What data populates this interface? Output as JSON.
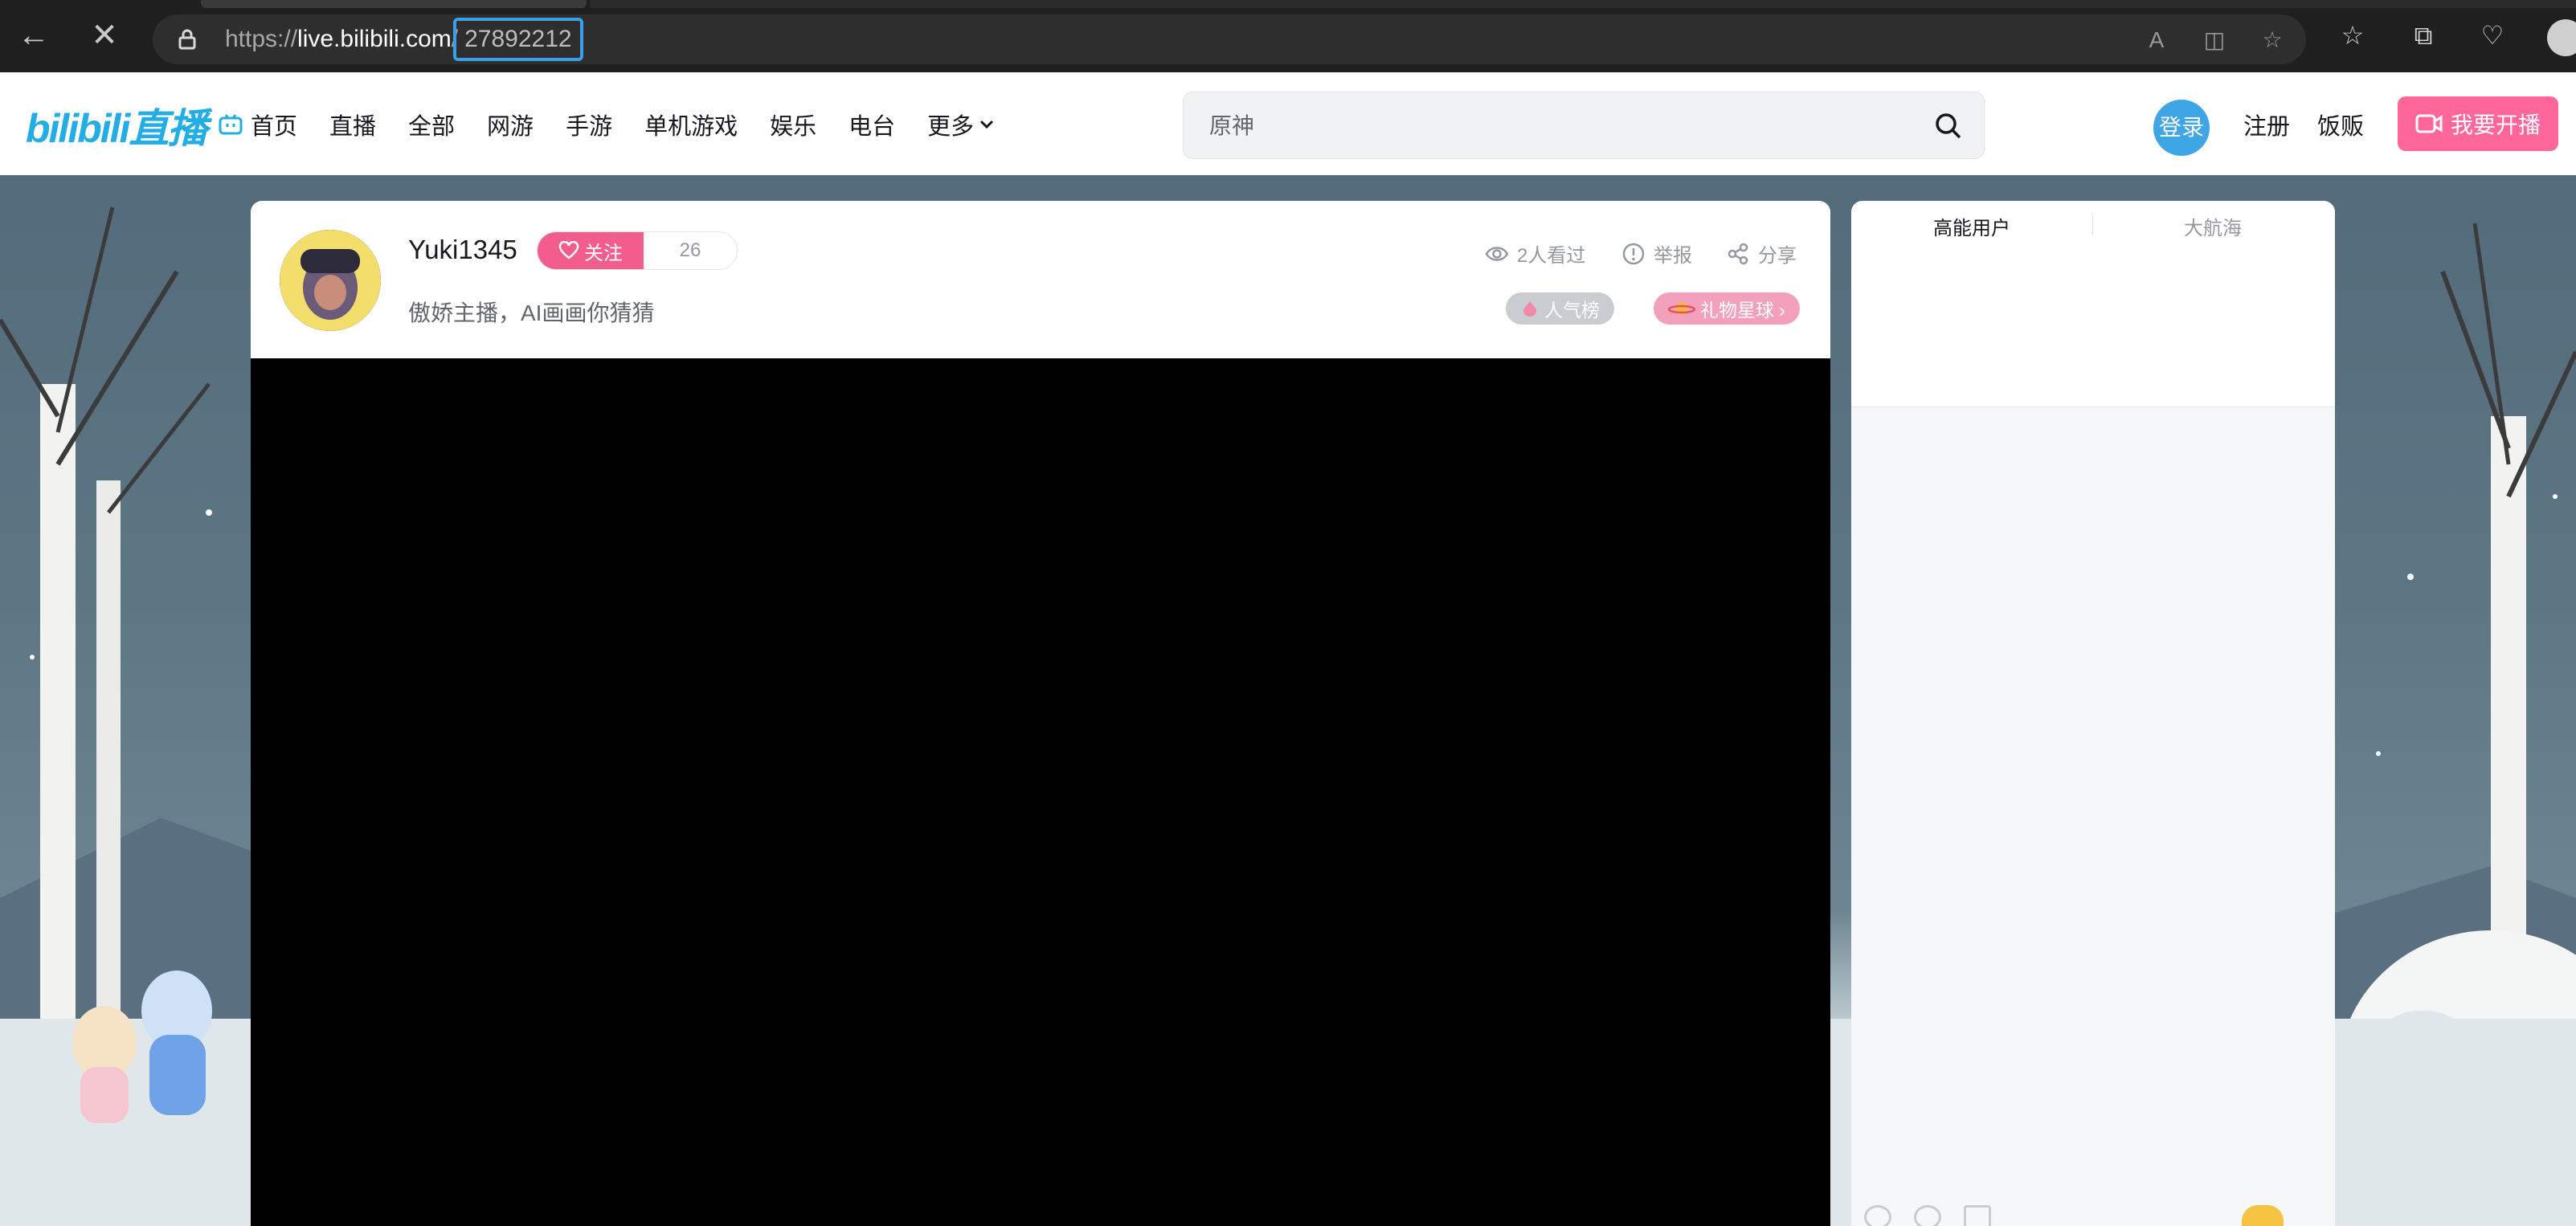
{
  "browser": {
    "url_prefix": "https://",
    "url_domain": "live.bilibili.com",
    "url_slash": "/",
    "url_path": "27892212",
    "back_glyph": "←",
    "stop_glyph": "✕"
  },
  "header": {
    "logo_text": "bilibili直播",
    "nav": [
      {
        "label": "首页",
        "icon": "tv-icon"
      },
      {
        "label": "直播"
      },
      {
        "label": "全部"
      },
      {
        "label": "网游"
      },
      {
        "label": "手游"
      },
      {
        "label": "单机游戏"
      },
      {
        "label": "娱乐"
      },
      {
        "label": "电台"
      },
      {
        "label": "更多"
      }
    ],
    "search_placeholder": "原神",
    "login_label": "登录",
    "register_label": "注册",
    "fanfan_label": "饭贩",
    "start_live_label": "我要开播"
  },
  "room": {
    "anchor_name": "Yuki1345",
    "follow_label": "关注",
    "follower_count": "26",
    "description": "傲娇主播，AI画画你猜猜",
    "viewed_label": "2人看过",
    "report_label": "举报",
    "share_label": "分享",
    "popularity_label": "人气榜",
    "gift_planet_label": "礼物星球 ›"
  },
  "side_panel": {
    "tab_high_energy": "高能用户",
    "tab_fleet": "大航海"
  },
  "colors": {
    "brand_blue": "#23ade5",
    "brand_pink": "#ff6699",
    "follow_pink": "#f25d8e",
    "url_highlight": "#3a9fe8"
  }
}
